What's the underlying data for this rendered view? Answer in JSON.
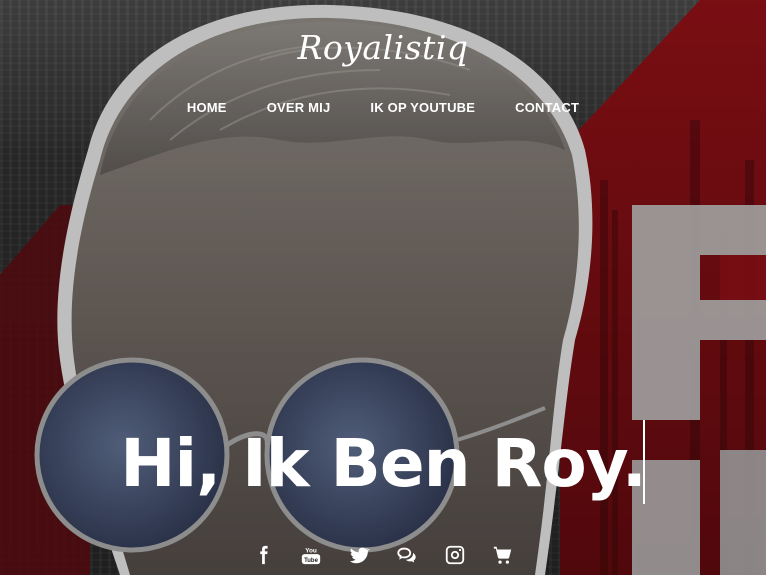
{
  "site": {
    "logo": "Royalistiq"
  },
  "nav": {
    "items": [
      {
        "label": "HOME"
      },
      {
        "label": "OVER MIJ"
      },
      {
        "label": "IK OP YOUTUBE"
      },
      {
        "label": "CONTACT"
      }
    ]
  },
  "hero": {
    "headline": "Hi, Ik Ben Roy."
  },
  "social": {
    "icons": [
      "facebook-icon",
      "youtube-icon",
      "twitter-icon",
      "chat-icon",
      "instagram-icon",
      "cart-icon"
    ]
  },
  "colors": {
    "accent_red": "#7e0f15",
    "text": "#ffffff"
  }
}
